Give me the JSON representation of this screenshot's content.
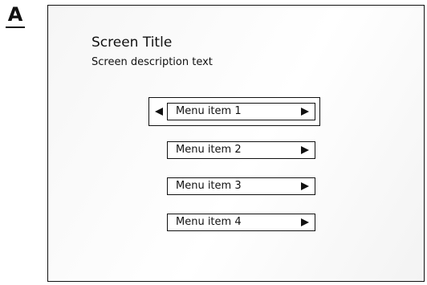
{
  "figure_label": "A",
  "screen": {
    "title": "Screen Title",
    "description": "Screen description text"
  },
  "menu": {
    "selected_index": 0,
    "items": [
      {
        "label": "Menu item 1",
        "icon_left": "arrow-left-icon",
        "icon_right": "arrow-right-icon"
      },
      {
        "label": "Menu item 2",
        "icon_right": "arrow-right-icon"
      },
      {
        "label": "Menu item 3",
        "icon_right": "arrow-right-icon"
      },
      {
        "label": "Menu item 4",
        "icon_right": "arrow-right-icon"
      }
    ]
  },
  "colors": {
    "line": "#111111",
    "background": "#ffffff"
  }
}
